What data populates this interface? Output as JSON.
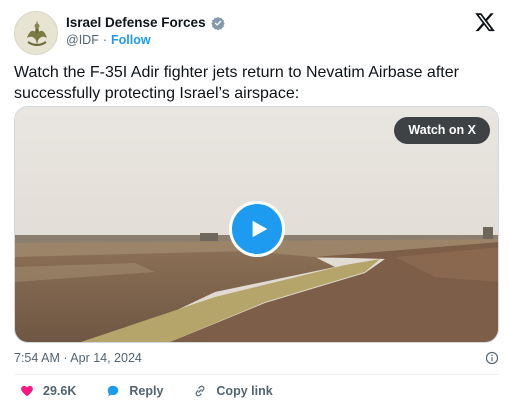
{
  "author": {
    "name": "Israel Defense Forces",
    "handle": "@IDF",
    "separator": "·",
    "follow_label": "Follow",
    "avatar_icon": "idf-emblem-icon",
    "verified_icon": "verified-badge-icon"
  },
  "tweet": {
    "text": "Watch the F-35I Adir fighter jets return to Nevatim Airbase after successfully protecting Israel’s airspace:"
  },
  "media": {
    "watch_label": "Watch on X",
    "play_icon": "play-icon"
  },
  "meta": {
    "timestamp": "7:54 AM · Apr 14, 2024",
    "info_icon": "info-icon"
  },
  "actions": {
    "like_count": "29.6K",
    "reply_label": "Reply",
    "copy_link_label": "Copy link"
  },
  "colors": {
    "accent": "#1d9bf0",
    "like": "#f91880",
    "text": "#0f1419",
    "muted": "#536471"
  }
}
